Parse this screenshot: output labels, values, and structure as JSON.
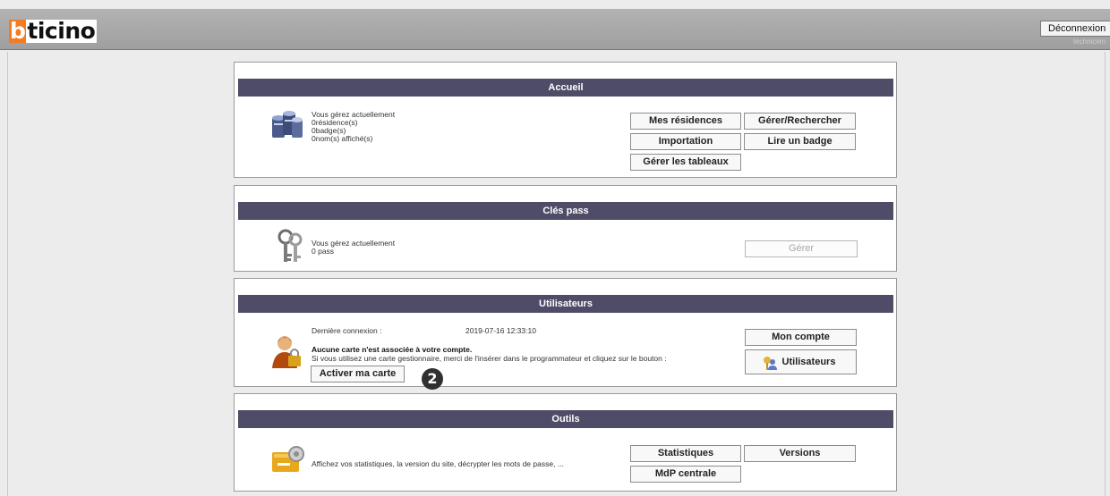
{
  "header": {
    "logo_first": "b",
    "logo_rest": "ticino",
    "logout_label": "Déconnexion",
    "user_label": "technicien"
  },
  "accueil": {
    "title": "Accueil",
    "info": [
      "Vous gérez actuellement",
      "0résidence(s)",
      "0badge(s)",
      "0nom(s) affiché(s)"
    ],
    "buttons": {
      "residences": "Mes résidences",
      "manage_search": "Gérer/Rechercher",
      "import": "Importation",
      "read_badge": "Lire un badge",
      "tables": "Gérer les tableaux"
    }
  },
  "cles": {
    "title": "Clés pass",
    "info": [
      "Vous gérez actuellement",
      "0 pass"
    ],
    "manage_button": "Gérer"
  },
  "utilisateurs": {
    "title": "Utilisateurs",
    "last_login_label": "Dernière connexion :",
    "last_login_value": "2019-07-16 12:33:10",
    "no_card": "Aucune carte n'est associée à votre compte.",
    "instructions": "Si vous utilisez une carte gestionnaire, merci de l'insérer dans le programmateur et cliquez sur le bouton :",
    "activate_button": "Activer ma carte",
    "account_button": "Mon compte",
    "users_button": "Utilisateurs"
  },
  "outils": {
    "title": "Outils",
    "description": "Affichez vos statistiques, la version du site, décrypter les mots de passe, ...",
    "stats_button": "Statistiques",
    "versions_button": "Versions",
    "mdp_button": "MdP centrale"
  },
  "callout": "2",
  "colors": {
    "section_bar": "#4f4c68",
    "logo_accent": "#f47b20"
  }
}
